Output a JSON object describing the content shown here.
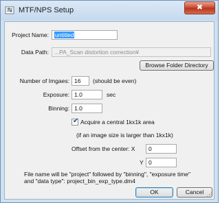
{
  "window": {
    "title": "MTF/NPS Setup",
    "close_symbol": "✖"
  },
  "icons": {
    "app": "app-settings-icon",
    "close": "close-icon",
    "check": "check-icon",
    "grip": "resize-grip-icon"
  },
  "form": {
    "project_name_label": "Project Name:",
    "project_name_value": "untitled",
    "data_path_label": "Data Path:",
    "data_path_value": "...PA_Scan distortion correction¥",
    "browse_button": "Browse Folder Directory",
    "num_images_label": "Number of Imgaes:",
    "num_images_value": "16",
    "num_images_hint": "(should be even)",
    "exposure_label": "Exposure:",
    "exposure_value": "1.0",
    "exposure_unit": "sec",
    "binning_label": "Binning:",
    "binning_value": "1.0",
    "acquire_label": "Acquire a central 1kx1k area",
    "acquire_checked": true,
    "acquire_note": "(if an image size is larger than 1kx1k)",
    "offset_label": "Offset from the center: X",
    "offset_x_value": "0",
    "offset_y_label": "Y",
    "offset_y_value": "0",
    "filename_note_1": "File name will be \"project\" followed by \"binning\", \"exposure time\"",
    "filename_note_2": "and \"data type\": project_bin_exp_type.dm4"
  },
  "buttons": {
    "ok": "OK",
    "cancel": "Cancel"
  },
  "colors": {
    "title_bar": "#cfe0f2",
    "close_button": "#c8452a",
    "selection": "#3399ff",
    "client_bg": "#f0f0f0"
  }
}
